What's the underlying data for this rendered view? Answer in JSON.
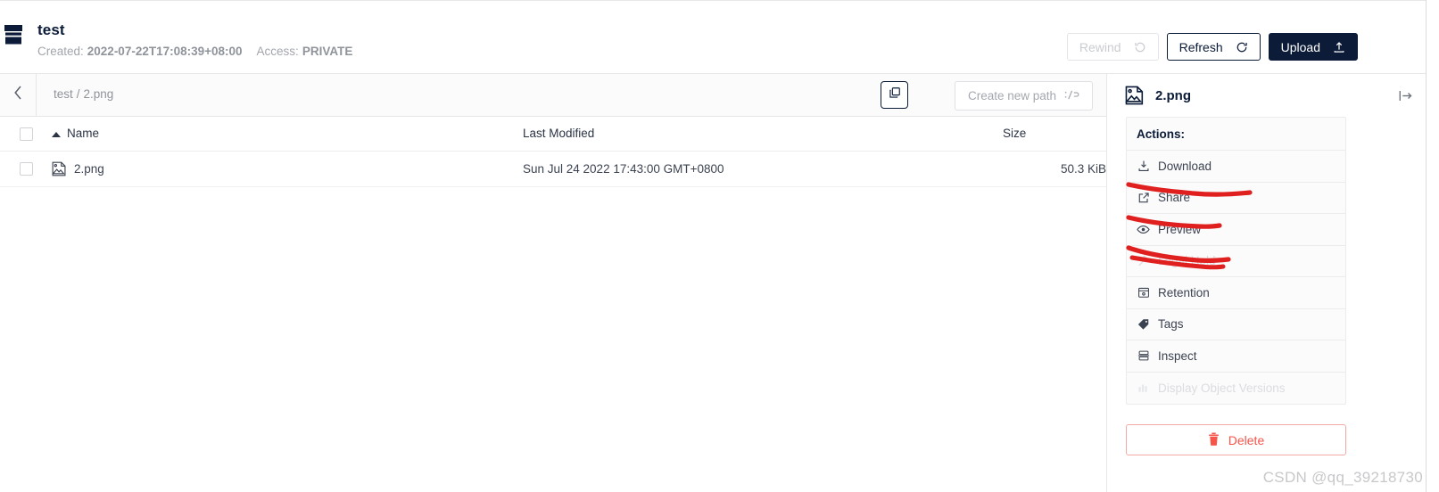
{
  "header": {
    "bucket_name": "test",
    "created_label": "Created:",
    "created_value": "2022-07-22T17:08:39+08:00",
    "access_label": "Access:",
    "access_value": "PRIVATE",
    "buttons": {
      "rewind": {
        "label": "Rewind",
        "icon": "rewind-icon",
        "disabled": true
      },
      "refresh": {
        "label": "Refresh",
        "icon": "refresh-icon",
        "disabled": false
      },
      "upload": {
        "label": "Upload",
        "icon": "upload-icon",
        "disabled": false
      }
    }
  },
  "breadcrumb": {
    "back_icon": "chevron-left-icon",
    "root": "test",
    "separator": "/",
    "current": "2.png",
    "copy_icon": "copy-icon",
    "create_path_label": "Create new path",
    "create_path_icon": "path-icon"
  },
  "table": {
    "columns": {
      "name": "Name",
      "last_modified": "Last Modified",
      "size": "Size"
    },
    "sort_indicator": "sort-ascending-icon",
    "rows": [
      {
        "icon": "image-file-icon",
        "name": "2.png",
        "last_modified": "Sun Jul 24 2022 17:43:00 GMT+0800",
        "size": "50.3 KiB"
      }
    ]
  },
  "detail_panel": {
    "file_icon": "image-file-icon",
    "file_name": "2.png",
    "collapse_icon": "collapse-right-icon",
    "actions_title": "Actions:",
    "actions": [
      {
        "label": "Download",
        "icon": "download-icon",
        "disabled": false,
        "annotated": true
      },
      {
        "label": "Share",
        "icon": "share-icon",
        "disabled": false,
        "annotated": true
      },
      {
        "label": "Preview",
        "icon": "eye-icon",
        "disabled": false,
        "annotated": true
      },
      {
        "label": "Legal Hold",
        "icon": "gavel-icon",
        "disabled": true,
        "annotated": true
      },
      {
        "label": "Retention",
        "icon": "calendar-icon",
        "disabled": false,
        "annotated": false
      },
      {
        "label": "Tags",
        "icon": "tag-icon",
        "disabled": false,
        "annotated": false
      },
      {
        "label": "Inspect",
        "icon": "inspect-icon",
        "disabled": false,
        "annotated": false
      },
      {
        "label": "Display Object Versions",
        "icon": "versions-icon",
        "disabled": true,
        "annotated": false
      }
    ],
    "delete": {
      "label": "Delete",
      "icon": "trash-icon"
    }
  },
  "watermark": "CSDN @qq_39218730",
  "colors": {
    "brand_navy": "#0b1b38",
    "danger_red": "#f5554a",
    "annotation_red": "#e01f1f",
    "muted_text": "#9a9ea5",
    "border": "#e6e7e9"
  }
}
